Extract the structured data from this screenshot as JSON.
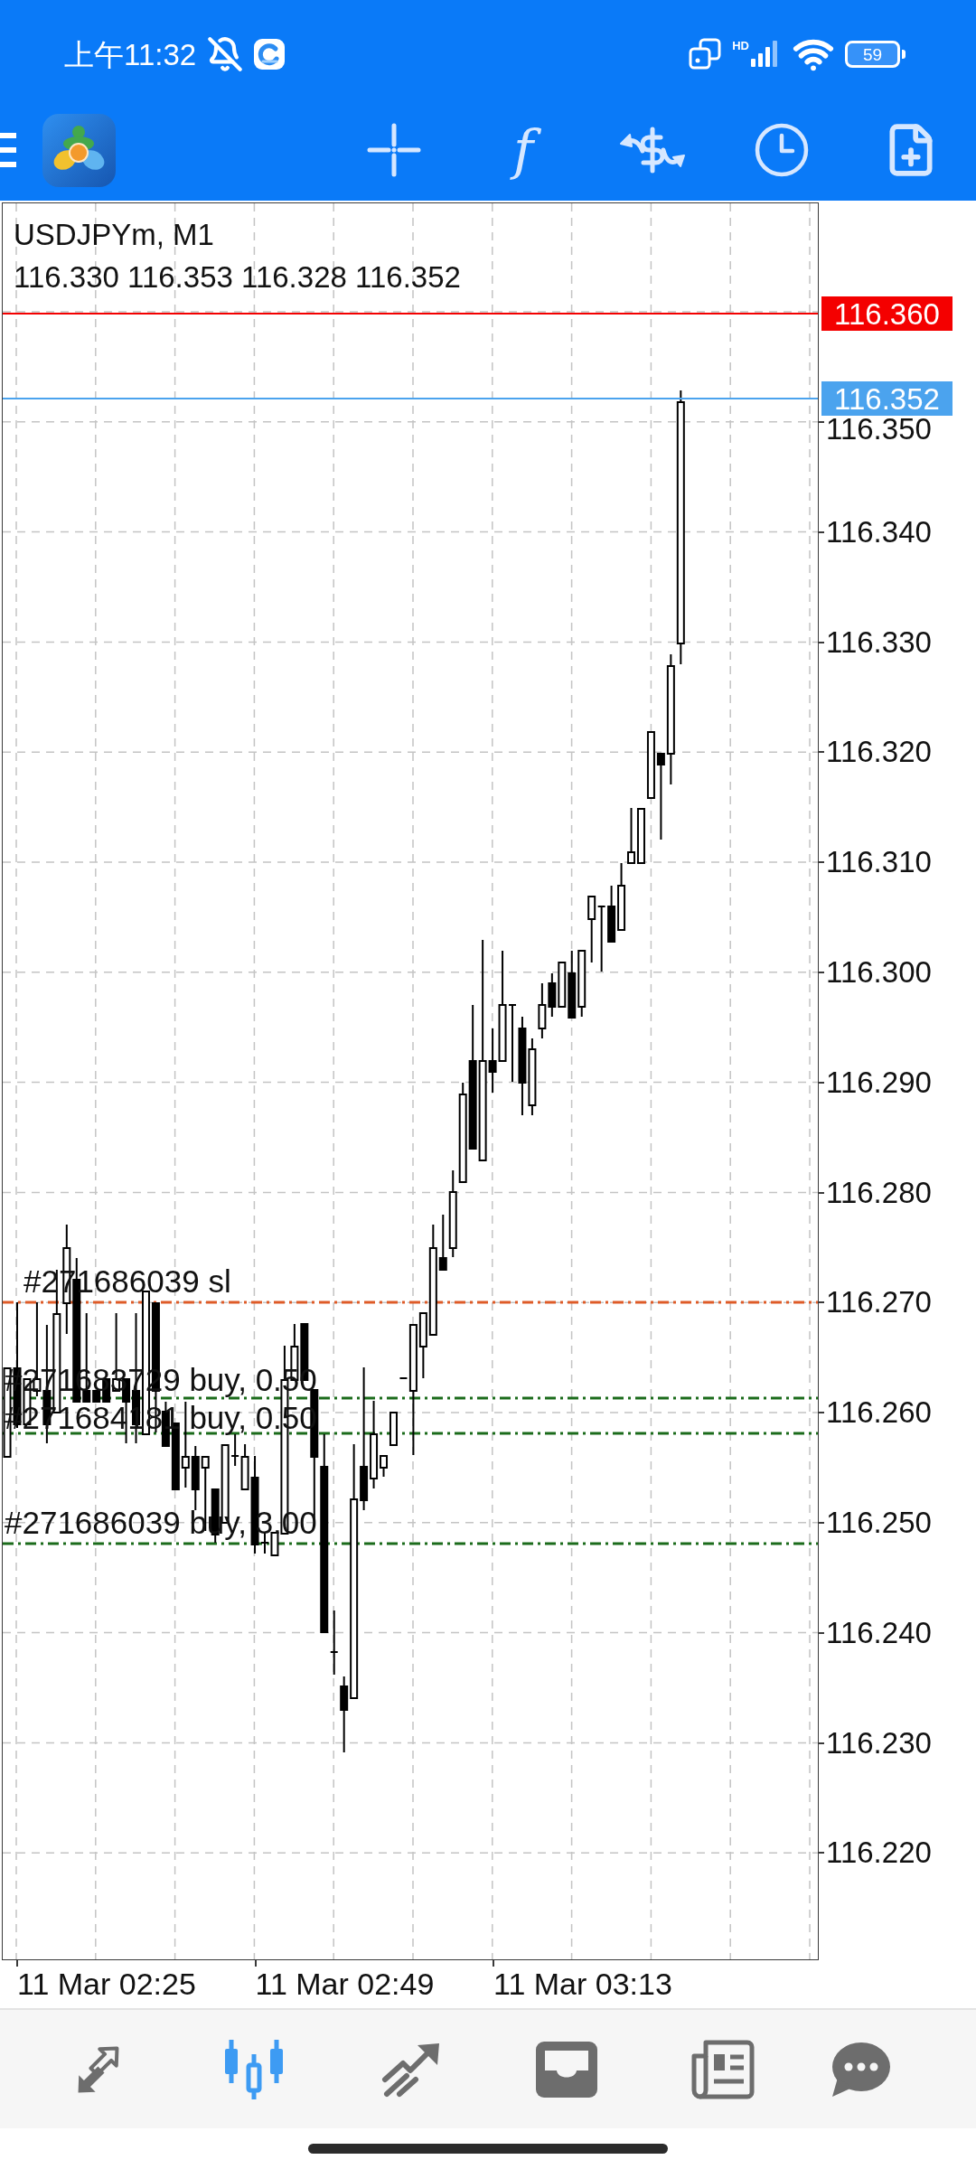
{
  "status_bar": {
    "time": "上午11:32",
    "network_type": "HD",
    "battery": "59"
  },
  "toolbar": {
    "function_label": "f"
  },
  "chart": {
    "symbol": "USDJPYm, M1",
    "ohlc": "116.330 116.353 116.328 116.352",
    "price_tags": [
      {
        "label": "116.360",
        "color": "#f40000"
      },
      {
        "label": "116.352",
        "color": "#4ba3ee"
      }
    ],
    "orders": [
      {
        "kind": "stop_loss",
        "label": "#271686039 sl",
        "color": "#de5b28"
      },
      {
        "kind": "position",
        "label": "#271683729 buy, 0.50",
        "color": "#1b6b1b"
      },
      {
        "kind": "position",
        "label": "#271684181 buy, 0.50",
        "color": "#1b6b1b"
      },
      {
        "kind": "position",
        "label": "#271686039 buy, 3.00",
        "color": "#1b6b1b"
      }
    ],
    "price_axis": [
      "116.350",
      "116.340",
      "116.330",
      "116.320",
      "116.310",
      "116.300",
      "116.290",
      "116.280",
      "116.270",
      "116.260",
      "116.250",
      "116.240",
      "116.230",
      "116.220"
    ],
    "time_axis": [
      "11 Mar 02:25",
      "11 Mar 02:49",
      "11 Mar 03:13"
    ]
  },
  "bottom_nav": [
    {
      "selected": false
    },
    {
      "selected": true
    },
    {
      "selected": false
    },
    {
      "selected": false
    },
    {
      "selected": false
    },
    {
      "selected": false
    }
  ]
}
